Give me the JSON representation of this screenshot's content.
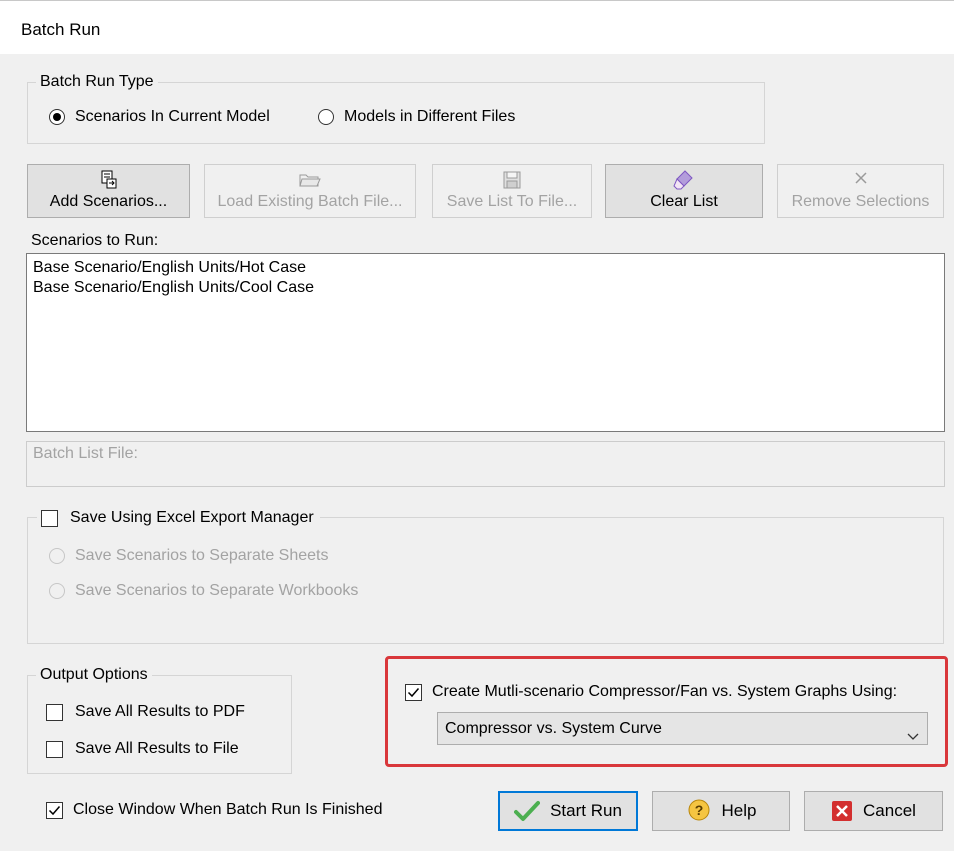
{
  "window": {
    "title": "Batch Run"
  },
  "batch_run_type": {
    "legend": "Batch Run Type",
    "options": [
      {
        "label": "Scenarios In Current Model",
        "selected": true
      },
      {
        "label": "Models in Different Files",
        "selected": false
      }
    ]
  },
  "toolbar": {
    "add_scenarios": {
      "label": "Add Scenarios...",
      "icon": "add-list-icon",
      "enabled": true
    },
    "load_batch_file": {
      "label": "Load Existing Batch File...",
      "icon": "open-folder-icon",
      "enabled": false
    },
    "save_list": {
      "label": "Save List To File...",
      "icon": "save-disk-icon",
      "enabled": false
    },
    "clear_list": {
      "label": "Clear List",
      "icon": "eraser-icon",
      "enabled": true
    },
    "remove_selections": {
      "label": "Remove Selections",
      "icon": "x-icon",
      "enabled": false
    }
  },
  "scenarios": {
    "label": "Scenarios to Run:",
    "items": [
      "Base Scenario/English Units/Hot Case",
      "Base Scenario/English Units/Cool Case"
    ]
  },
  "batch_list_file": {
    "label": "Batch List File:"
  },
  "excel_export": {
    "label": "Save Using Excel Export Manager",
    "checked": false,
    "options": [
      {
        "label": "Save Scenarios to Separate Sheets",
        "enabled": false
      },
      {
        "label": "Save Scenarios to Separate Workbooks",
        "enabled": false
      }
    ]
  },
  "output_options": {
    "legend": "Output Options",
    "pdf": {
      "label": "Save All Results to PDF",
      "checked": false
    },
    "file": {
      "label": "Save All Results to File",
      "checked": false
    }
  },
  "multi_scenario": {
    "label": "Create Mutli-scenario Compressor/Fan vs. System Graphs Using:",
    "checked": true,
    "selected_graph": "Compressor vs. System Curve"
  },
  "close_window": {
    "label": "Close Window When Batch Run Is Finished",
    "checked": true
  },
  "actions": {
    "start": "Start Run",
    "help": "Help",
    "cancel": "Cancel"
  },
  "colors": {
    "highlight": "#d9373b",
    "focus": "#0078d7",
    "cancel_icon": "#d32f2f",
    "start_icon": "#4caf50"
  }
}
